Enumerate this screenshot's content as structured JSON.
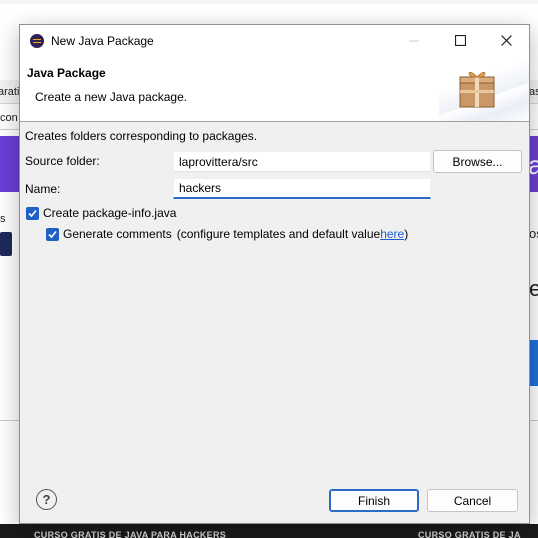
{
  "background": {
    "row1_left": "arati",
    "row1_right": "as",
    "row2_left": "con",
    "banner_right": "a",
    "mid_right_top": "os",
    "mid_right_big": "e",
    "mid_left": "s",
    "bottom_left": "CURSO GRATIS DE JAVA PARA HACKERS",
    "bottom_right": "CURSO GRATIS DE JA",
    "banner_color": "#6b3fd6",
    "blue_button_color": "#1f6fe0"
  },
  "window": {
    "title": "New Java Package",
    "app_icon": "eclipse-icon",
    "controls": {
      "minimize": "minimize-icon",
      "maximize": "maximize-icon",
      "close": "close-icon"
    }
  },
  "header": {
    "title": "Java Package",
    "subtitle": "Create a new Java package.",
    "graphic": "package-icon"
  },
  "body": {
    "description": "Creates folders corresponding to packages.",
    "source_folder": {
      "label": "Source folder:",
      "value": "laprovittera/src",
      "browse_label": "Browse..."
    },
    "name": {
      "label": "Name:",
      "value": "hackers"
    },
    "create_package_info": {
      "label": "Create package-info.java",
      "checked": true
    },
    "generate_comments": {
      "label": "Generate comments",
      "hint": "(configure templates and default value ",
      "link": "here",
      "hint_end": ")",
      "checked": true
    }
  },
  "footer": {
    "help_icon": "help-icon",
    "help_glyph": "?",
    "finish_label": "Finish",
    "cancel_label": "Cancel"
  },
  "colors": {
    "accent": "#1f60c4",
    "focus": "#2a6ac9",
    "link": "#1a5fd1",
    "dialog_bg": "#f0f0f0"
  }
}
